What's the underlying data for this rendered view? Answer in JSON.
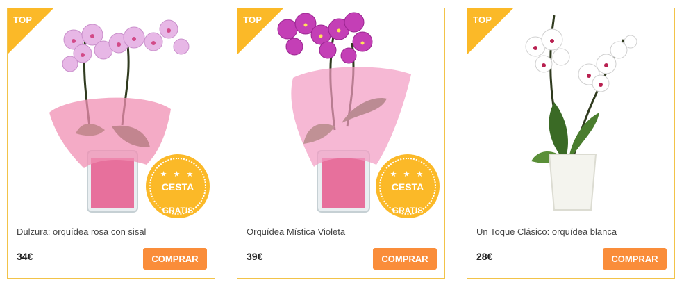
{
  "products": [
    {
      "ribbon": "TOP",
      "name": "Dulzura: orquídea rosa con sisal",
      "price": "34€",
      "button": "COMPRAR",
      "badge": {
        "stars": "★ ★ ★",
        "title": "CESTA",
        "subtitle": "GRATIS"
      },
      "image_icon": "pink-orchid-in-glass-vase",
      "flower_color": "#e7b7e6",
      "wrap_color": "#f08fb3"
    },
    {
      "ribbon": "TOP",
      "name": "Orquídea Mística Violeta",
      "price": "39€",
      "button": "COMPRAR",
      "badge": {
        "stars": "★ ★ ★",
        "title": "CESTA",
        "subtitle": "GRATIS"
      },
      "image_icon": "violet-orchid-in-glass-vase",
      "flower_color": "#c43fb6",
      "wrap_color": "#f29ac2"
    },
    {
      "ribbon": "TOP",
      "name": "Un Toque Clásico: orquídea blanca",
      "price": "28€",
      "button": "COMPRAR",
      "image_icon": "white-orchid-in-white-pot",
      "flower_color": "#ffffff",
      "wrap_color": "#f5f5f0"
    }
  ],
  "colors": {
    "accent": "#fbb928",
    "button": "#fa8d3a",
    "border": "#f2c349"
  }
}
